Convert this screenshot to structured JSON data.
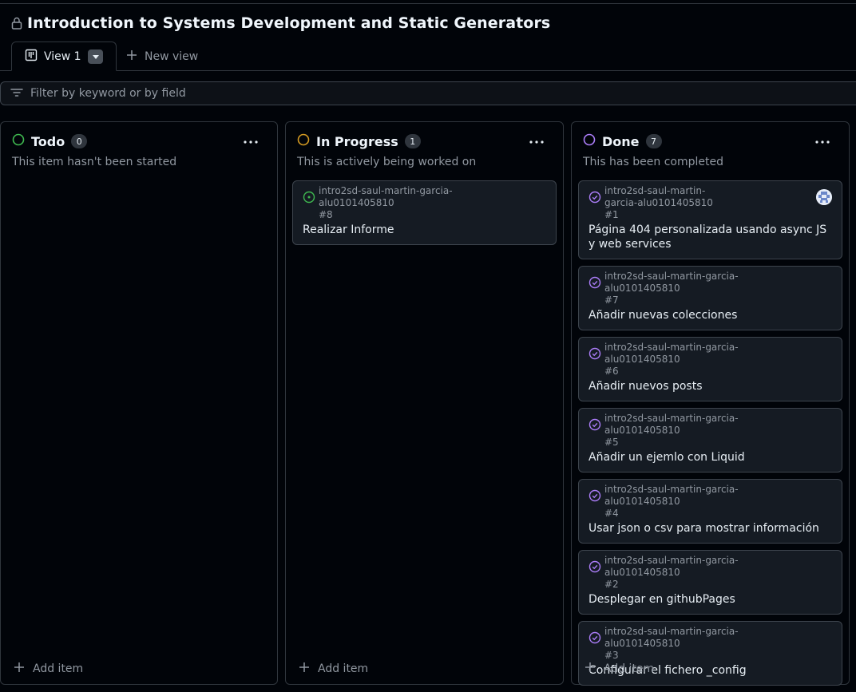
{
  "project": {
    "title": "Introduction to Systems Development and Static Generators"
  },
  "tabs": {
    "active_label": "View 1",
    "new_view_label": "New view"
  },
  "filter": {
    "placeholder": "Filter by keyword or by field"
  },
  "colors": {
    "todo": "#3fb950",
    "in_progress": "#d29922",
    "done": "#ab7df8",
    "open_issue": "#3fb950"
  },
  "columns": [
    {
      "name": "Todo",
      "count": "0",
      "description": "This item hasn't been started",
      "status_icon": "todo-circle-icon",
      "add_label": "Add item",
      "cards": []
    },
    {
      "name": "In Progress",
      "count": "1",
      "description": "This is actively being worked on",
      "status_icon": "in-progress-circle-icon",
      "add_label": "Add item",
      "cards": [
        {
          "repo": "intro2sd-saul-martin-garcia-alu0101405810",
          "number": "#8",
          "title": "Realizar Informe",
          "icon": "issue-opened-icon"
        }
      ]
    },
    {
      "name": "Done",
      "count": "7",
      "description": "This has been completed",
      "status_icon": "done-circle-icon",
      "add_label": "Add item",
      "cards": [
        {
          "repo": "intro2sd-saul-martin-garcia-alu0101405810",
          "number": "#1",
          "title": "Página 404 personalizada usando async JS y web services",
          "icon": "issue-closed-icon",
          "has_avatar": true
        },
        {
          "repo": "intro2sd-saul-martin-garcia-alu0101405810",
          "number": "#7",
          "title": "Añadir nuevas colecciones",
          "icon": "issue-closed-icon"
        },
        {
          "repo": "intro2sd-saul-martin-garcia-alu0101405810",
          "number": "#6",
          "title": "Añadir nuevos posts",
          "icon": "issue-closed-icon"
        },
        {
          "repo": "intro2sd-saul-martin-garcia-alu0101405810",
          "number": "#5",
          "title": "Añadir un ejemlo con Liquid",
          "icon": "issue-closed-icon"
        },
        {
          "repo": "intro2sd-saul-martin-garcia-alu0101405810",
          "number": "#4",
          "title": "Usar json o csv para mostrar información",
          "icon": "issue-closed-icon"
        },
        {
          "repo": "intro2sd-saul-martin-garcia-alu0101405810",
          "number": "#2",
          "title": "Desplegar en githubPages",
          "icon": "issue-closed-icon"
        },
        {
          "repo": "intro2sd-saul-martin-garcia-alu0101405810",
          "number": "#3",
          "title": "Configurar el fichero _config",
          "icon": "issue-closed-icon"
        }
      ]
    }
  ]
}
